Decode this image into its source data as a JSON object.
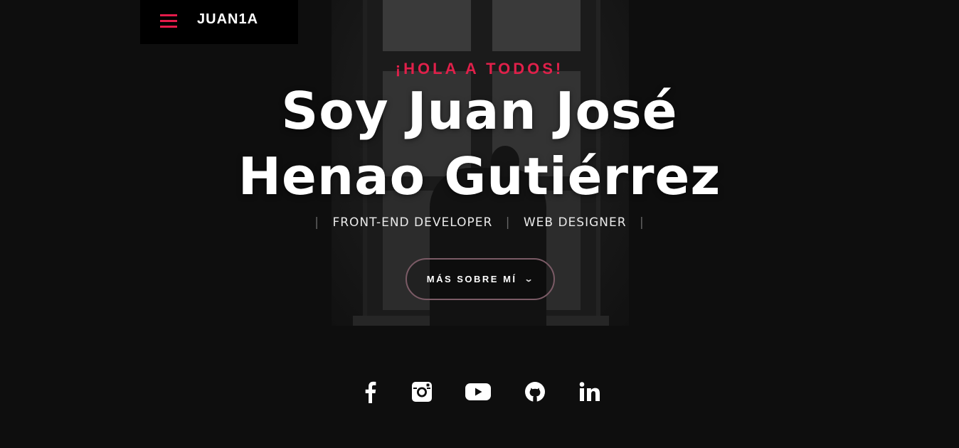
{
  "brand": {
    "name": "JUAN1A"
  },
  "hero": {
    "greeting": "¡HOLA A TODOS!",
    "title_line1": "Soy Juan José",
    "title_line2": "Henao Gutiérrez",
    "roles": [
      "FRONT-END DEVELOPER",
      "WEB DESIGNER"
    ],
    "button_label": "MÁS SOBRE MÍ"
  },
  "socials": [
    "facebook-icon",
    "instagram-icon",
    "youtube-icon",
    "github-icon",
    "linkedin-icon"
  ],
  "colors": {
    "accent": "#e31b4a",
    "background": "#0e0e0e",
    "button_border": "#7b5b66",
    "text": "#ffffff"
  }
}
